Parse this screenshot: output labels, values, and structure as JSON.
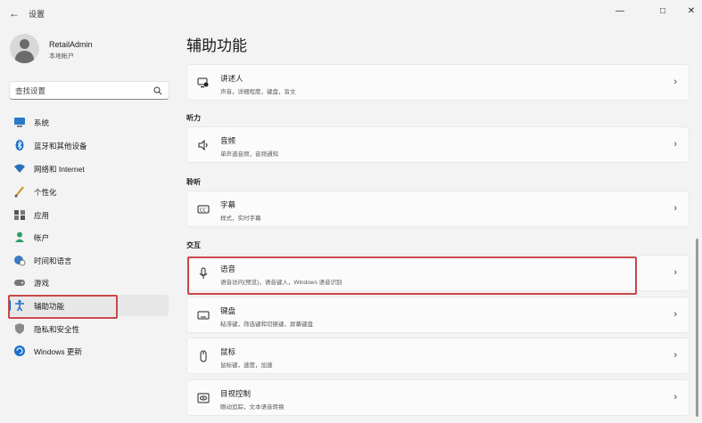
{
  "window": {
    "title": "设置",
    "back_icon": "←",
    "minimize_icon": "—",
    "maximize_icon": "□",
    "close_icon": "✕"
  },
  "user": {
    "name": "RetailAdmin",
    "account_type": "本地帐户"
  },
  "search": {
    "placeholder": "查找设置"
  },
  "sidebar": {
    "items": [
      {
        "label": "系统",
        "icon": "monitor-icon"
      },
      {
        "label": "蓝牙和其他设备",
        "icon": "bluetooth-icon"
      },
      {
        "label": "网络和 Internet",
        "icon": "wifi-icon"
      },
      {
        "label": "个性化",
        "icon": "brush-icon"
      },
      {
        "label": "应用",
        "icon": "apps-icon"
      },
      {
        "label": "帐户",
        "icon": "person-icon"
      },
      {
        "label": "时间和语言",
        "icon": "globe-clock-icon"
      },
      {
        "label": "游戏",
        "icon": "gamepad-icon"
      },
      {
        "label": "辅助功能",
        "icon": "accessibility-icon",
        "selected": true
      },
      {
        "label": "隐私和安全性",
        "icon": "shield-icon"
      },
      {
        "label": "Windows 更新",
        "icon": "update-icon"
      }
    ]
  },
  "main": {
    "title": "辅助功能",
    "sections": {
      "hearing": "听力",
      "hearing2": "聆听",
      "interaction": "交互"
    },
    "cards": [
      {
        "title": "讲述人",
        "desc": "声音，详细程度，键盘，盲文"
      },
      {
        "title": "音频",
        "desc": "单声道音频，音频通知"
      },
      {
        "title": "字幕",
        "desc": "样式，实时字幕"
      },
      {
        "title": "语音",
        "desc": "语音访问(预览)，语音键入，Windows 语音识别"
      },
      {
        "title": "键盘",
        "desc": "粘滞键，筛选键和切换键，屏幕键盘"
      },
      {
        "title": "鼠标",
        "desc": "鼠标键，速度，加速"
      },
      {
        "title": "目视控制",
        "desc": "眼动追踪，文本语音转换"
      }
    ],
    "chevron": "›"
  },
  "colors": {
    "accent": "#0067c0",
    "highlight_box": "#c9484a"
  }
}
